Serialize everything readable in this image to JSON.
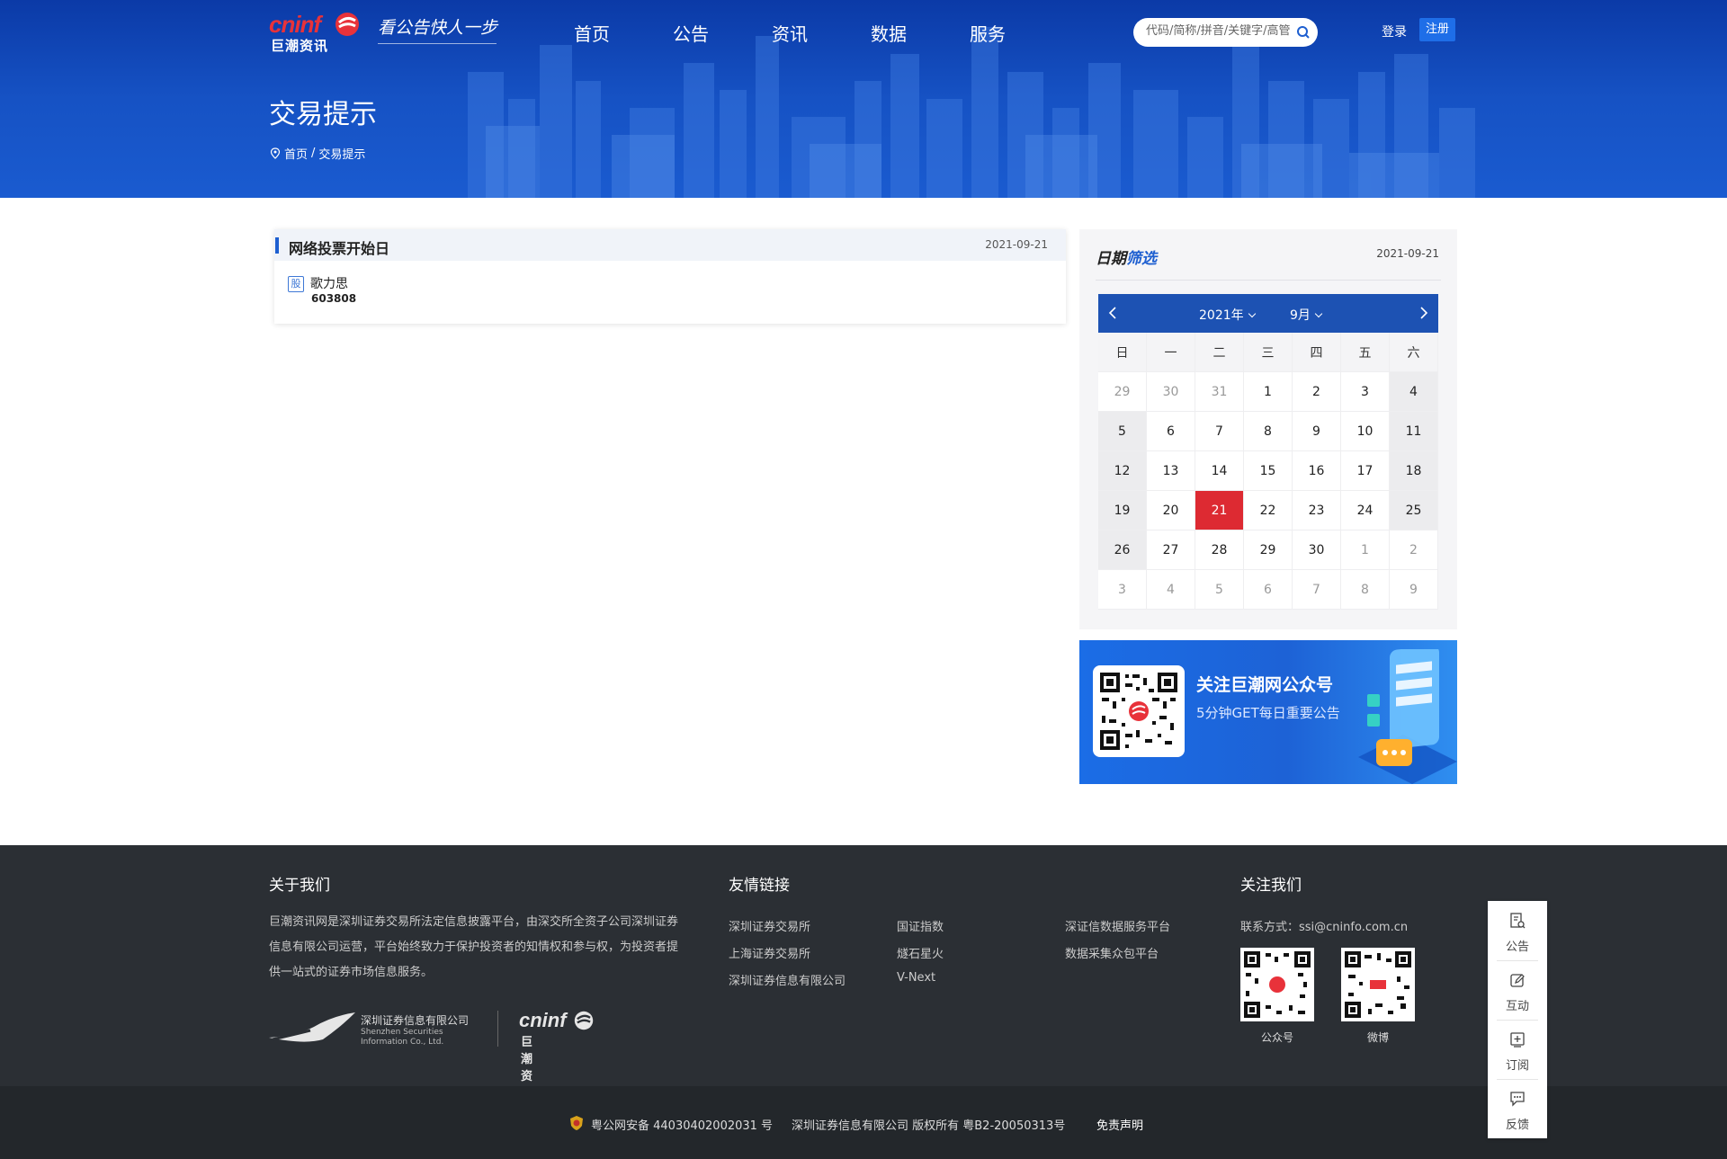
{
  "header": {
    "logo_en": "cninf",
    "logo_zh": "巨潮资讯",
    "slogan": "看公告快人一步",
    "nav": [
      "首页",
      "公告",
      "资讯",
      "数据",
      "服务"
    ],
    "search_placeholder": "代码/简称/拼音/关键字/高管",
    "login": "登录",
    "register": "注册",
    "page_title": "交易提示",
    "breadcrumb": [
      "首页",
      "/",
      "交易提示"
    ]
  },
  "notice": {
    "title": "网络投票开始日",
    "date": "2021-09-21",
    "badge": "股",
    "stock_name": "歌力思",
    "stock_code": "603808"
  },
  "calendar": {
    "title_a": "日期",
    "title_b": "筛选",
    "date": "2021-09-21",
    "year": "2021年",
    "month": "9月",
    "weekdays": [
      "日",
      "一",
      "二",
      "三",
      "四",
      "五",
      "六"
    ],
    "weeks": [
      [
        "29",
        "30",
        "31",
        "1",
        "2",
        "3",
        "4"
      ],
      [
        "5",
        "6",
        "7",
        "8",
        "9",
        "10",
        "11"
      ],
      [
        "12",
        "13",
        "14",
        "15",
        "16",
        "17",
        "18"
      ],
      [
        "19",
        "20",
        "21",
        "22",
        "23",
        "24",
        "25"
      ],
      [
        "26",
        "27",
        "28",
        "29",
        "30",
        "1",
        "2"
      ],
      [
        "3",
        "4",
        "5",
        "6",
        "7",
        "8",
        "9"
      ]
    ],
    "selected": "21",
    "accent": "#dd2a32",
    "header_color": "#1d52b3"
  },
  "banner": {
    "title": "关注巨潮网公众号",
    "subtitle": "5分钟GET每日重要公告"
  },
  "footer": {
    "about_title": "关于我们",
    "about_text": "巨潮资讯网是深圳证券交易所法定信息披露平台，由深交所全资子公司深圳证券信息有限公司运营，平台始终致力于保护投资者的知情权和参与权，为投资者提供一站式的证券市场信息服务。",
    "szsi_cn": "深圳证券信息有限公司",
    "szsi_en1": "Shenzhen Securities",
    "szsi_en2": "Information Co., Ltd.",
    "links_title": "友情链接",
    "links": [
      "深圳证券交易所",
      "国证指数",
      "深证信数据服务平台",
      "上海证券交易所",
      "燧石星火",
      "数据采集众包平台",
      "深圳证券信息有限公司",
      "V-Next"
    ],
    "follow_title": "关注我们",
    "contact": "联系方式：ssi@cninfo.com.cn",
    "qr_labels": [
      "公众号",
      "微博"
    ],
    "icp": "粤公网安备 44030402002031 号",
    "copyright": "深圳证券信息有限公司 版权所有 粤B2-20050313号",
    "disclaimer": "免责声明"
  },
  "side": [
    "公告",
    "互动",
    "订阅",
    "反馈"
  ]
}
